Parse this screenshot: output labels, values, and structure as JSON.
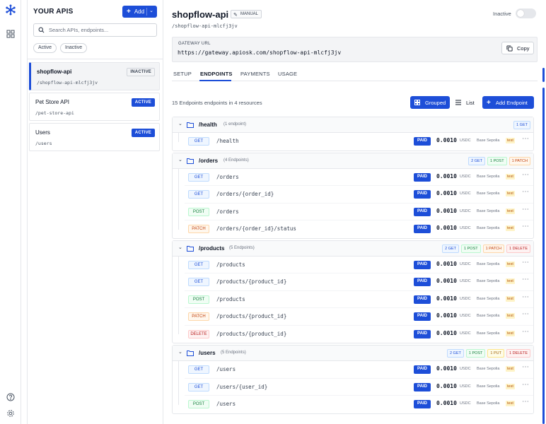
{
  "sidebar": {
    "title": "YOUR APIS",
    "add_label": "Add",
    "search_placeholder": "Search APIs, endpoints...",
    "filters": [
      "Active",
      "Inactive"
    ],
    "apis": [
      {
        "name": "shopflow-api",
        "slug": "/shopflow-api-mlcfj3jv",
        "status": "INACTIVE"
      },
      {
        "name": "Pet Store API",
        "slug": "/pet-store-api",
        "status": "ACTIVE"
      },
      {
        "name": "Users",
        "slug": "/users",
        "status": "ACTIVE"
      }
    ]
  },
  "main": {
    "title": "shopflow-api",
    "mode_badge": "MANUAL",
    "slug": "/shopflow-api-mlcfj3jv",
    "status_label": "Inactive",
    "gateway_label": "GATEWAY URL",
    "gateway_url": "https://gateway.apiosk.com/shopflow-api-mlcfj3jv",
    "copy_label": "Copy",
    "tabs": [
      "SETUP",
      "ENDPOINTS",
      "PAYMENTS",
      "USAGE"
    ],
    "active_tab": "ENDPOINTS",
    "summary": "15 Endpoints endpoints in 4 resources",
    "view_grouped": "Grouped",
    "view_list": "List",
    "add_endpoint": "Add Endpoint"
  },
  "groups": [
    {
      "path": "/health",
      "count": "(1 endpoint)",
      "badges": [
        {
          "label": "1 GET",
          "kind": "get"
        }
      ],
      "endpoints": [
        {
          "method": "GET",
          "path": "/health",
          "pay": "PAID",
          "price": "0.0010",
          "currency": "USDC",
          "network": "Base Sepolia",
          "env": "test"
        }
      ]
    },
    {
      "path": "/orders",
      "count": "(4 Endpoints)",
      "badges": [
        {
          "label": "2 GET",
          "kind": "get"
        },
        {
          "label": "1 POST",
          "kind": "post"
        },
        {
          "label": "1 PATCH",
          "kind": "patch"
        }
      ],
      "endpoints": [
        {
          "method": "GET",
          "path": "/orders",
          "pay": "PAID",
          "price": "0.0010",
          "currency": "USDC",
          "network": "Base Sepolia",
          "env": "test"
        },
        {
          "method": "GET",
          "path": "/orders/{order_id}",
          "pay": "PAID",
          "price": "0.0010",
          "currency": "USDC",
          "network": "Base Sepolia",
          "env": "test"
        },
        {
          "method": "POST",
          "path": "/orders",
          "pay": "PAID",
          "price": "0.0010",
          "currency": "USDC",
          "network": "Base Sepolia",
          "env": "test"
        },
        {
          "method": "PATCH",
          "path": "/orders/{order_id}/status",
          "pay": "PAID",
          "price": "0.0010",
          "currency": "USDC",
          "network": "Base Sepolia",
          "env": "test"
        }
      ]
    },
    {
      "path": "/products",
      "count": "(5 Endpoints)",
      "badges": [
        {
          "label": "2 GET",
          "kind": "get"
        },
        {
          "label": "1 POST",
          "kind": "post"
        },
        {
          "label": "1 PATCH",
          "kind": "patch"
        },
        {
          "label": "1 DELETE",
          "kind": "delete"
        }
      ],
      "endpoints": [
        {
          "method": "GET",
          "path": "/products",
          "pay": "PAID",
          "price": "0.0010",
          "currency": "USDC",
          "network": "Base Sepolia",
          "env": "test"
        },
        {
          "method": "GET",
          "path": "/products/{product_id}",
          "pay": "PAID",
          "price": "0.0010",
          "currency": "USDC",
          "network": "Base Sepolia",
          "env": "test"
        },
        {
          "method": "POST",
          "path": "/products",
          "pay": "PAID",
          "price": "0.0010",
          "currency": "USDC",
          "network": "Base Sepolia",
          "env": "test"
        },
        {
          "method": "PATCH",
          "path": "/products/{product_id}",
          "pay": "PAID",
          "price": "0.0010",
          "currency": "USDC",
          "network": "Base Sepolia",
          "env": "test"
        },
        {
          "method": "DELETE",
          "path": "/products/{product_id}",
          "pay": "PAID",
          "price": "0.0010",
          "currency": "USDC",
          "network": "Base Sepolia",
          "env": "test"
        }
      ]
    },
    {
      "path": "/users",
      "count": "(5 Endpoints)",
      "badges": [
        {
          "label": "2 GET",
          "kind": "get"
        },
        {
          "label": "1 POST",
          "kind": "post"
        },
        {
          "label": "1 PUT",
          "kind": "put"
        },
        {
          "label": "1 DELETE",
          "kind": "delete"
        }
      ],
      "endpoints": [
        {
          "method": "GET",
          "path": "/users",
          "pay": "PAID",
          "price": "0.0010",
          "currency": "USDC",
          "network": "Base Sepolia",
          "env": "test"
        },
        {
          "method": "GET",
          "path": "/users/{user_id}",
          "pay": "PAID",
          "price": "0.0010",
          "currency": "USDC",
          "network": "Base Sepolia",
          "env": "test"
        },
        {
          "method": "POST",
          "path": "/users",
          "pay": "PAID",
          "price": "0.0010",
          "currency": "USDC",
          "network": "Base Sepolia",
          "env": "test"
        }
      ]
    }
  ],
  "colors": {
    "accent": "#1d4ed8",
    "border": "#e5e7eb"
  },
  "icons": [
    "app-logo-icon",
    "grid-icon",
    "help-icon",
    "settings-icon",
    "search-icon",
    "copy-icon",
    "folder-icon",
    "chevron-down-icon",
    "pencil-icon",
    "list-icon",
    "grouped-icon",
    "more-icon"
  ]
}
